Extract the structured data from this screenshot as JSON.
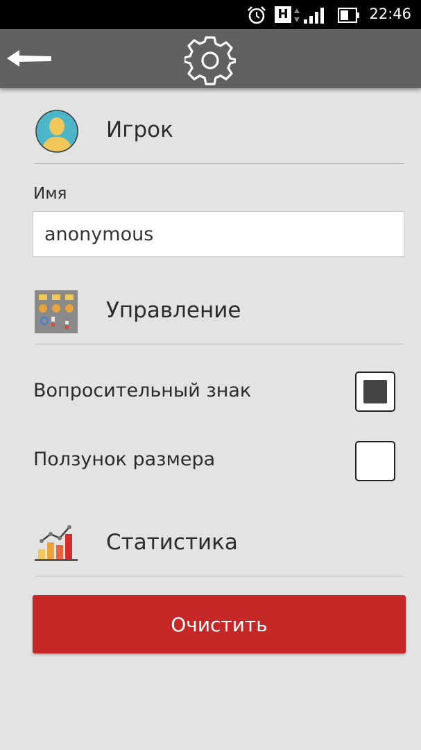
{
  "status_bar": {
    "time": "22:46",
    "network_badge": "H",
    "icons": [
      "alarm-icon",
      "signal-icon",
      "battery-icon"
    ]
  },
  "toolbar": {
    "back_icon": "arrow-left-icon",
    "title_icon": "gear-icon"
  },
  "sections": {
    "player": {
      "title": "Игрок",
      "icon": "user-avatar-icon"
    },
    "controls": {
      "title": "Управление",
      "icon": "control-panel-icon"
    },
    "stats": {
      "title": "Статистика",
      "icon": "bar-chart-icon"
    }
  },
  "player": {
    "name_label": "Имя",
    "name_value": "anonymous"
  },
  "controls": {
    "question_mark_label": "Вопросительный знак",
    "question_mark_checked": true,
    "size_slider_label": "Ползунок размера",
    "size_slider_checked": false
  },
  "clear_button_label": "Очистить",
  "colors": {
    "toolbar": "#616161",
    "background": "#e3e3e3",
    "accent_red": "#c62828"
  }
}
